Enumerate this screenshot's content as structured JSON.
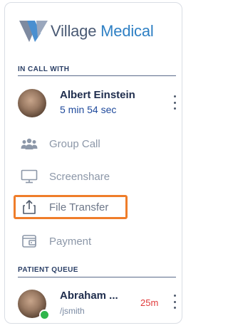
{
  "brand": {
    "word1": "Village",
    "word2": "Medical"
  },
  "in_call": {
    "heading": "IN CALL WITH",
    "name": "Albert Einstein",
    "duration": "5 min 54 sec"
  },
  "menu": [
    {
      "label": "Group Call",
      "icon": "group-icon"
    },
    {
      "label": "Screenshare",
      "icon": "monitor-icon"
    },
    {
      "label": "File Transfer",
      "icon": "upload-icon",
      "highlighted": true
    },
    {
      "label": "Payment",
      "icon": "wallet-icon"
    }
  ],
  "queue": {
    "heading": "PATIENT QUEUE",
    "patients": [
      {
        "name": "Abraham ...",
        "username": "/jsmith",
        "wait": "25m",
        "status": "online"
      }
    ]
  },
  "colors": {
    "highlight": "#ef7d2a",
    "brand_blue": "#2f80c4",
    "brand_gray": "#4a5a74",
    "wait_time": "#e03a3a",
    "online": "#2fb54b"
  }
}
